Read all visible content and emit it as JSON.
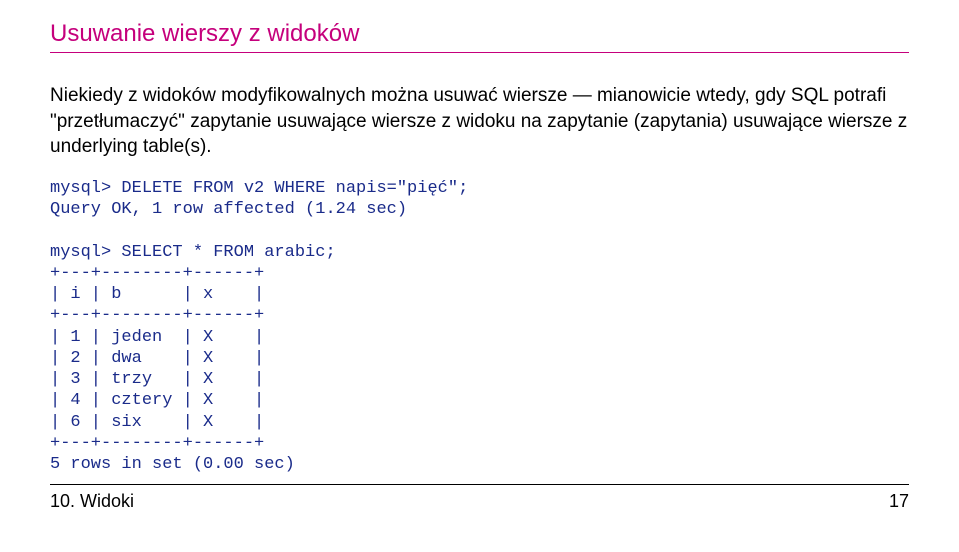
{
  "heading": "Usuwanie wierszy z widoków",
  "paragraph": "Niekiedy z widoków modyfikowalnych można usuwać wiersze — mianowicie wtedy, gdy SQL potrafi \"przetłumaczyć\" zapytanie usuwające wiersze z widoku na zapytanie (zapytania) usuwające wiersze z underlying table(s).",
  "code": "mysql> DELETE FROM v2 WHERE napis=\"pięć\";\nQuery OK, 1 row affected (1.24 sec)\n\nmysql> SELECT * FROM arabic;\n+---+--------+------+\n| i | b      | x    |\n+---+--------+------+\n| 1 | jeden  | X    |\n| 2 | dwa    | X    |\n| 3 | trzy   | X    |\n| 4 | cztery | X    |\n| 6 | six    | X    |\n+---+--------+------+\n5 rows in set (0.00 sec)",
  "footer": {
    "left": "10. Widoki",
    "right": "17"
  }
}
